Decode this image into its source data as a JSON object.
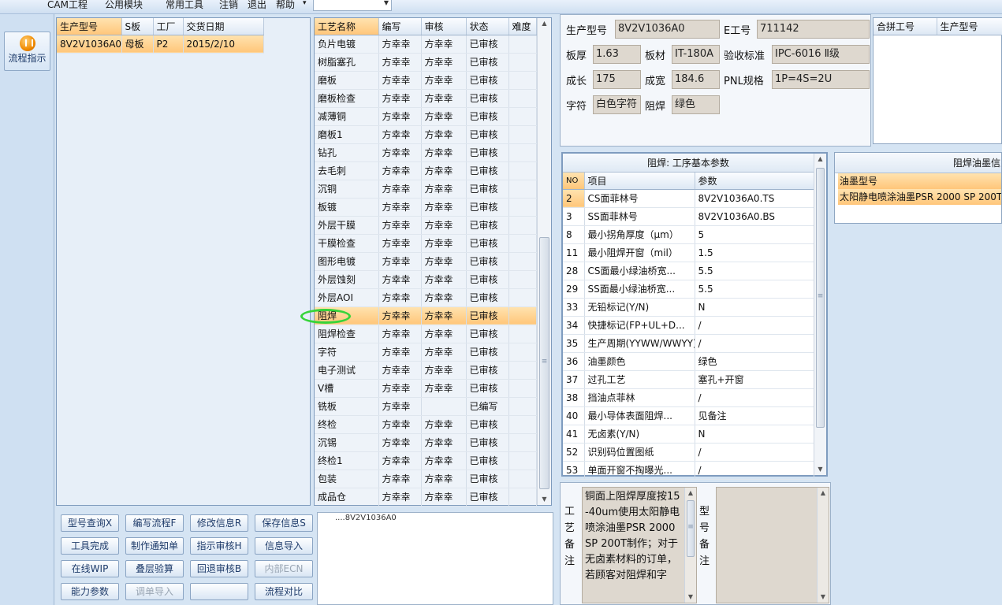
{
  "menu": {
    "items": [
      "CAM工程",
      "公用模块",
      "常用工具",
      "注销",
      "退出",
      "帮助"
    ],
    "help_arrow": "▾"
  },
  "rail": {
    "flow_button_label": "流程指示"
  },
  "orders": {
    "headers": [
      "生产型号",
      "S板",
      "工厂",
      "交货日期"
    ],
    "rows": [
      {
        "model": "8V2V1036A0",
        "board": "母板",
        "factory": "P2",
        "date": "2015/2/10"
      }
    ]
  },
  "process": {
    "headers": [
      "工艺名称",
      "编写",
      "审核",
      "状态",
      "难度"
    ],
    "rows": [
      [
        "负片电镀",
        "方幸幸",
        "方幸幸",
        "已审核"
      ],
      [
        "树脂塞孔",
        "方幸幸",
        "方幸幸",
        "已审核"
      ],
      [
        "磨板",
        "方幸幸",
        "方幸幸",
        "已审核"
      ],
      [
        "磨板检查",
        "方幸幸",
        "方幸幸",
        "已审核"
      ],
      [
        "减薄铜",
        "方幸幸",
        "方幸幸",
        "已审核"
      ],
      [
        "磨板1",
        "方幸幸",
        "方幸幸",
        "已审核"
      ],
      [
        "钻孔",
        "方幸幸",
        "方幸幸",
        "已审核"
      ],
      [
        "去毛刺",
        "方幸幸",
        "方幸幸",
        "已审核"
      ],
      [
        "沉铜",
        "方幸幸",
        "方幸幸",
        "已审核"
      ],
      [
        "板镀",
        "方幸幸",
        "方幸幸",
        "已审核"
      ],
      [
        "外层干膜",
        "方幸幸",
        "方幸幸",
        "已审核"
      ],
      [
        "干膜检查",
        "方幸幸",
        "方幸幸",
        "已审核"
      ],
      [
        "图形电镀",
        "方幸幸",
        "方幸幸",
        "已审核"
      ],
      [
        "外层蚀刻",
        "方幸幸",
        "方幸幸",
        "已审核"
      ],
      [
        "外层AOI",
        "方幸幸",
        "方幸幸",
        "已审核"
      ],
      [
        "阻焊",
        "方幸幸",
        "方幸幸",
        "已审核"
      ],
      [
        "阻焊检查",
        "方幸幸",
        "方幸幸",
        "已审核"
      ],
      [
        "字符",
        "方幸幸",
        "方幸幸",
        "已审核"
      ],
      [
        "电子测试",
        "方幸幸",
        "方幸幸",
        "已审核"
      ],
      [
        "V槽",
        "方幸幸",
        "方幸幸",
        "已审核"
      ],
      [
        "铣板",
        "方幸幸",
        "",
        "已编写"
      ],
      [
        "终检",
        "方幸幸",
        "方幸幸",
        "已审核"
      ],
      [
        "沉锡",
        "方幸幸",
        "方幸幸",
        "已审核"
      ],
      [
        "终检1",
        "方幸幸",
        "方幸幸",
        "已审核"
      ],
      [
        "包装",
        "方幸幸",
        "方幸幸",
        "已审核"
      ],
      [
        "成品仓",
        "方幸幸",
        "方幸幸",
        "已审核"
      ]
    ],
    "selected_index": 15
  },
  "note_box": {
    "text": "....8V2V1036A0"
  },
  "buttons": [
    [
      "型号查询X",
      "编写流程F",
      "修改信息R",
      "保存信息S"
    ],
    [
      "工具完成",
      "制作通知单",
      "指示审核H",
      "信息导入"
    ],
    [
      "在线WIP",
      "叠层验算",
      "回退审核B",
      "内部ECN"
    ],
    [
      "能力参数",
      "调单导入",
      "",
      "流程对比"
    ]
  ],
  "disabled_buttons": [
    "内部ECN",
    "调单导入"
  ],
  "info": {
    "model_label": "生产型号",
    "model": "8V2V1036A0",
    "e_label": "E工号",
    "e_no": "711142",
    "thick_label": "板厚",
    "thick": "1.63",
    "material_label": "板材",
    "material": "IT-180A",
    "std_label": "验收标准",
    "std": "IPC-6016 Ⅱ级",
    "len_label": "成长",
    "len": "175",
    "wid_label": "成宽",
    "wid": "184.6",
    "pnl_label": "PNL规格",
    "pnl": "1P=4S=2U",
    "char_label": "字符",
    "char": "白色字符",
    "mask_label": "阻焊",
    "mask": "绿色"
  },
  "combine": {
    "headers": [
      "合拼工号",
      "生产型号"
    ]
  },
  "params": {
    "title": "阻焊: 工序基本参数",
    "headers": [
      "NO",
      "项目",
      "参数"
    ],
    "rows": [
      [
        "2",
        "CS面菲林号",
        "8V2V1036A0.TS"
      ],
      [
        "3",
        "SS面菲林号",
        "8V2V1036A0.BS"
      ],
      [
        "8",
        "最小拐角厚度（μm）",
        "5"
      ],
      [
        "11",
        "最小阻焊开窗（mil）",
        "1.5"
      ],
      [
        "28",
        "CS面最小绿油桥宽...",
        "5.5"
      ],
      [
        "29",
        "SS面最小绿油桥宽...",
        "5.5"
      ],
      [
        "33",
        "无铅标记(Y/N)",
        "N"
      ],
      [
        "34",
        "快捷标记(FP+UL+D...",
        "/"
      ],
      [
        "35",
        "生产周期(YYWW/WWYY)",
        "/"
      ],
      [
        "36",
        "油墨颜色",
        "绿色"
      ],
      [
        "37",
        "过孔工艺",
        "塞孔+开窗"
      ],
      [
        "38",
        "挡油点菲林",
        "/"
      ],
      [
        "40",
        "最小导体表面阻焊...",
        "见备注"
      ],
      [
        "41",
        "无卤素(Y/N)",
        "N"
      ],
      [
        "52",
        "识别码位置图纸",
        "/"
      ],
      [
        "53",
        "单面开窗不掏曝光...",
        "/"
      ]
    ]
  },
  "ink": {
    "title": "阻焊油墨信息",
    "header": "油墨型号",
    "row": "太阳静电喷涂油墨PSR 2000 SP 200T"
  },
  "remarks": {
    "proc_label": [
      "工",
      "艺",
      "备",
      "注"
    ],
    "proc_text": "铜面上阻焊厚度按15-40um使用太阳静电喷涂油墨PSR 2000 SP 200T制作；对于无卤素材料的订单，若顾客对阻焊和字",
    "model_label": [
      "型",
      "号",
      "备",
      "注"
    ]
  }
}
